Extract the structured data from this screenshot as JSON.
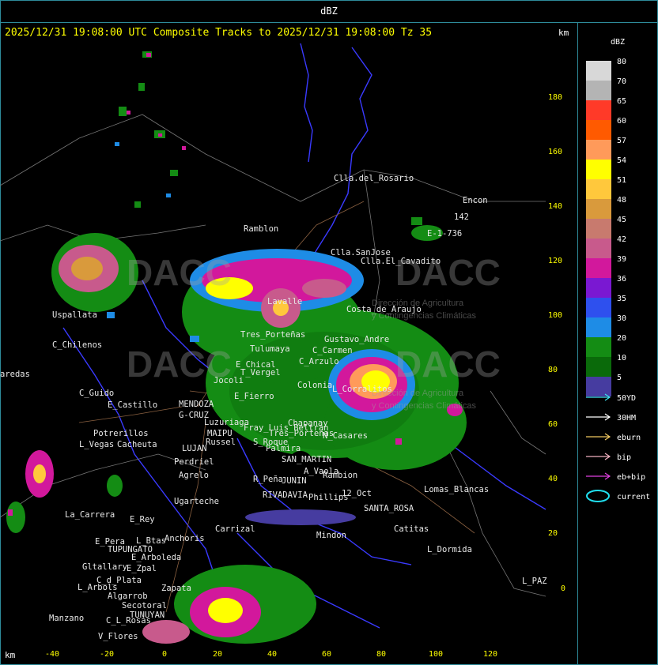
{
  "window": {
    "title": "dBZ"
  },
  "header": {
    "title": "2025/12/31 19:08:00 UTC Composite Tracks to 2025/12/31 19:08:00 Tz 35",
    "km_top": "km",
    "km_bottom": "km"
  },
  "axes": {
    "y_ticks": [
      "180",
      "160",
      "140",
      "120",
      "100",
      "80",
      "60",
      "40",
      "20",
      "0"
    ],
    "x_ticks": [
      "-40",
      "-20",
      "0",
      "20",
      "40",
      "60",
      "80",
      "100",
      "120"
    ]
  },
  "watermark": {
    "brand": "DACC",
    "subtitle_line1": "Dirección de Agricultura",
    "subtitle_line2": "y Contingencias Climáticas"
  },
  "places": [
    "Clla.del_Rosario",
    "Encon",
    "142",
    "E-1-736",
    "Ramblon",
    "Clla.SanJose",
    "Clla.El_Cavadito",
    "Uspallata",
    "C_Chilenos",
    "aredas",
    "C_Guido",
    "E_Castillo",
    "MENDOZA",
    "G-CRUZ",
    "Luzuriaga",
    "Potrerillos",
    "Cacheuta",
    "MAIPU",
    "LUJAN",
    "Russel",
    "Perdriel",
    "Agrelo",
    "Ugarteche",
    "L_Vegas",
    "Tres_Porteñas",
    "Tulumaya",
    "E_Chical",
    "T_Vergel",
    "Jocoli",
    "Costa_de_Araujo",
    "Lavalle",
    "Gustavo_Andre",
    "C_Carmen",
    "C_Arzulo",
    "Colonia",
    "E_Fierro",
    "L_Corralitos",
    "Fray_Luis_Beltran",
    "Palmira",
    "Chapanay",
    "Tres_Porteñas",
    "S_Roque",
    "N_Casares",
    "SAN_MARTIN",
    "A_Vaola",
    "Rambion",
    "R_Peña",
    "JUNIN",
    "RIVADAVIA",
    "Phillips",
    "12_Oct",
    "SANTA_ROSA",
    "Lomas_Blancas",
    "Catitas",
    "Mindon",
    "L_Dormida",
    "L_PAZ",
    "Carrizal",
    "La_Carrera",
    "E_Rey",
    "Anchoris",
    "TUPUNGATO",
    "E_Pera",
    "E_Arboleda",
    "Gltallary",
    "E_Zpal",
    "C_d_Plata",
    "L_Arbols",
    "Zapata",
    "Algarrob",
    "Secotoral",
    "TUNUYAN",
    "Manzano",
    "C_L_Rosas",
    "V_Flores",
    "L_Btas"
  ],
  "legend": {
    "title": "dBZ",
    "items": [
      {
        "label": "80",
        "color": "#d8d8d8"
      },
      {
        "label": "70",
        "color": "#b4b4b4"
      },
      {
        "label": "65",
        "color": "#ff3a28"
      },
      {
        "label": "60",
        "color": "#ff5a00"
      },
      {
        "label": "57",
        "color": "#ff9a5a"
      },
      {
        "label": "54",
        "color": "#ffff00"
      },
      {
        "label": "51",
        "color": "#ffc83c"
      },
      {
        "label": "48",
        "color": "#d99a3c"
      },
      {
        "label": "45",
        "color": "#c87a6e"
      },
      {
        "label": "42",
        "color": "#c85a8c"
      },
      {
        "label": "39",
        "color": "#d2189c"
      },
      {
        "label": "36",
        "color": "#7a18d2"
      },
      {
        "label": "35",
        "color": "#2e50ee"
      },
      {
        "label": "30",
        "color": "#1e8ce6"
      },
      {
        "label": "20",
        "color": "#148c14"
      },
      {
        "label": "10",
        "color": "#0a6a0a"
      },
      {
        "label": "5",
        "color": "#463ca0"
      }
    ],
    "tracks": [
      {
        "label": "50YD",
        "color": "#40e0f0"
      },
      {
        "label": "30HM",
        "color": "#ffffff"
      },
      {
        "label": "eburn",
        "color": "#f0c860"
      },
      {
        "label": "bip",
        "color": "#f0b0c0"
      },
      {
        "label": "eb+bip",
        "color": "#e040e0"
      },
      {
        "label": "current",
        "color": "#20e0f0"
      }
    ]
  },
  "colors": {
    "frame": "#2e8b9a",
    "header": "#ffff00",
    "axis": "#ffff00",
    "border": "#3a3aff",
    "road": "#8a6040"
  }
}
